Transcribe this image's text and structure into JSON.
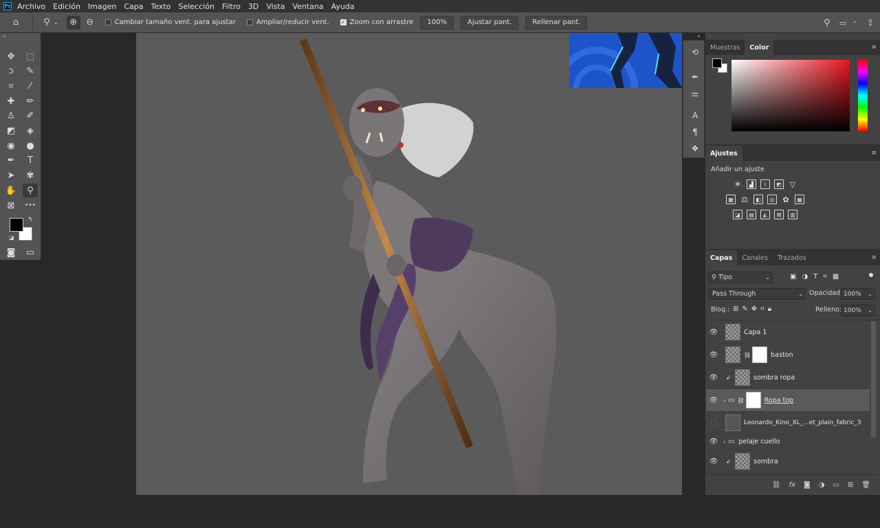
{
  "menubar": {
    "logo": "Ps",
    "items": [
      "Archivo",
      "Edición",
      "Imagen",
      "Capa",
      "Texto",
      "Selección",
      "Filtro",
      "3D",
      "Vista",
      "Ventana",
      "Ayuda"
    ]
  },
  "options": {
    "resize_windows": "Cambiar tamaño vent. para ajustar",
    "resize_windows_checked": false,
    "zoom_all": "Ampliar/reducir vent.",
    "zoom_all_checked": false,
    "scrubby_zoom": "Zoom con arrastre",
    "scrubby_zoom_checked": true,
    "zoom_pct": "100%",
    "fit_screen": "Ajustar pant.",
    "fill_screen": "Rellenar pant."
  },
  "tools": [
    {
      "name": "move-tool",
      "glyph": "✥"
    },
    {
      "name": "marquee-tool",
      "glyph": "⬚"
    },
    {
      "name": "lasso-tool",
      "glyph": "ↄ"
    },
    {
      "name": "quick-select-tool",
      "glyph": "✎"
    },
    {
      "name": "crop-tool",
      "glyph": "⌗"
    },
    {
      "name": "eyedropper-tool",
      "glyph": "⁄"
    },
    {
      "name": "healing-brush-tool",
      "glyph": "✚"
    },
    {
      "name": "brush-tool",
      "glyph": "✏"
    },
    {
      "name": "clone-stamp-tool",
      "glyph": "♙"
    },
    {
      "name": "history-brush-tool",
      "glyph": "✐"
    },
    {
      "name": "eraser-tool",
      "glyph": "◩"
    },
    {
      "name": "paint-bucket-tool",
      "glyph": "◈"
    },
    {
      "name": "blur-tool",
      "glyph": "◉"
    },
    {
      "name": "dodge-tool",
      "glyph": "●"
    },
    {
      "name": "pen-tool",
      "glyph": "✒"
    },
    {
      "name": "type-tool",
      "glyph": "T"
    },
    {
      "name": "path-select-tool",
      "glyph": "➤"
    },
    {
      "name": "custom-shape-tool",
      "glyph": "✾"
    },
    {
      "name": "hand-tool",
      "glyph": "✋"
    },
    {
      "name": "zoom-tool",
      "glyph": "⚲"
    },
    {
      "name": "frame-tool",
      "glyph": "⊠"
    },
    {
      "name": "more-tools",
      "glyph": "•••"
    }
  ],
  "colors": {
    "foreground": "#000000",
    "background": "#ffffff",
    "canvas": "#5b5b5b",
    "ui_dark": "#282828",
    "panel": "#424242"
  },
  "panels": {
    "color_tabs": [
      "Muestras",
      "Color"
    ],
    "adjust_tab": "Ajustes",
    "adjust_hint": "Añadir un ajuste",
    "layers_tabs": [
      "Capas",
      "Canales",
      "Trazados"
    ],
    "filter_kind": "Tipo",
    "blend_mode": "Pass Through",
    "opacity_label": "Opacidad:",
    "opacity": "100%",
    "lock_label": "Bloq.:",
    "fill_label": "Relleno:",
    "fill": "100%"
  },
  "layers": [
    {
      "name": "Capa 1",
      "visible": true,
      "mask": false,
      "clip": false,
      "group": false,
      "selected": false
    },
    {
      "name": "baston",
      "visible": true,
      "mask": true,
      "clip": false,
      "group": false,
      "selected": false
    },
    {
      "name": "sombra ropa",
      "visible": true,
      "mask": false,
      "clip": true,
      "group": false,
      "selected": false
    },
    {
      "name": "Ropa top",
      "visible": true,
      "mask": true,
      "clip": false,
      "group": true,
      "selected": true
    },
    {
      "name": "Leonardo_Kino_XL_...et_plain_fabric_3",
      "visible": false,
      "mask": false,
      "clip": false,
      "group": false,
      "selected": false
    },
    {
      "name": "pelaje cuello",
      "visible": true,
      "mask": false,
      "clip": false,
      "group": true,
      "selected": false
    },
    {
      "name": "sombra",
      "visible": true,
      "mask": false,
      "clip": true,
      "group": false,
      "selected": false
    }
  ],
  "icons": {
    "home": "home-icon",
    "zoom": "zoom-icon",
    "search": "search-icon",
    "workspace": "workspace-icon",
    "share": "share-icon",
    "eye": "eye-icon",
    "folder": "folder-icon",
    "link": "chain-link-icon",
    "trash": "trash-icon",
    "fx": "fx-icon",
    "new-layer": "new-layer-icon"
  }
}
